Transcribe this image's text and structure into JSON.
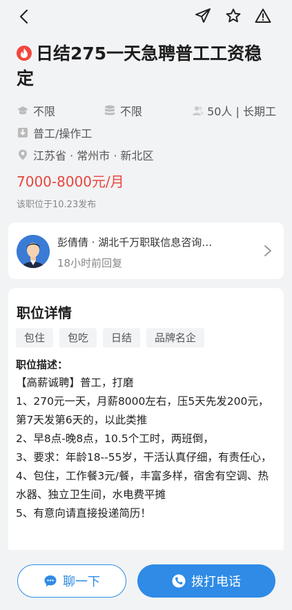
{
  "job": {
    "title": "日结275一天急聘普工工资稳定",
    "education": "不限",
    "experience": "不限",
    "headcount": "50人 | 长期工",
    "category": "普工/操作工",
    "location": "江苏省 · 常州市 · 新北区",
    "salary": "7000-8000元/月",
    "posted": "该职位于10.23发布"
  },
  "recruiter": {
    "name": "彭倩倩 · 湖北千万职联信息咨询…",
    "reply_time": "18小时前回复"
  },
  "detail": {
    "heading": "职位详情",
    "tags": [
      "包住",
      "包吃",
      "日结",
      "品牌名企"
    ],
    "desc_title": "职位描述：",
    "lines": [
      "【高薪诚聘】普工，打磨",
      "1、270元一天，月薪8000左右，压5天先发200元，第7天发第6天的，以此类推",
      "2、早8点-晚8点，10.5个工时，两班倒，",
      "3、要求：年龄18--55岁，干活认真仔细，有责任心，",
      "4、包住，工作餐3元/餐，丰富多样，宿舍有空调、热水器、独立卫生间，水电费平摊",
      "5、有意向请直接投递简历！"
    ]
  },
  "actions": {
    "chat_label": "聊一下",
    "call_label": "拨打电话"
  },
  "icons": {
    "back": "chevron-left-icon",
    "share": "send-icon",
    "favorite": "star-icon",
    "report": "warning-icon",
    "hot": "fire-icon",
    "education": "graduation-cap-icon",
    "experience": "database-icon",
    "headcount": "people-icon",
    "category": "download-box-icon",
    "location": "location-pin-icon",
    "arrow": "chevron-right-icon",
    "chat": "chat-bubble-icon",
    "call": "phone-icon"
  },
  "colors": {
    "accent": "#2f8be6",
    "salary": "#e8453c",
    "hot": "#f2463d",
    "background": "#f2f3f5"
  }
}
